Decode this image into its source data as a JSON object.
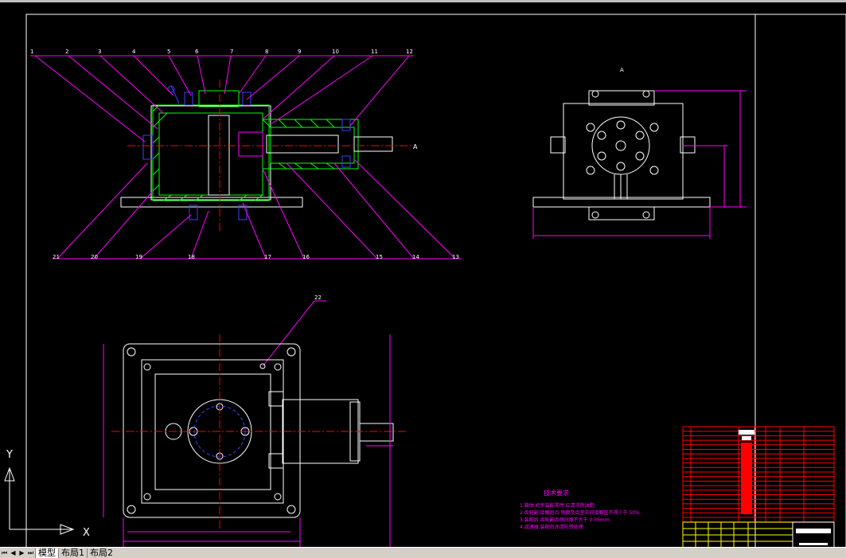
{
  "drawing": {
    "part_labels_top": [
      "1",
      "2",
      "3",
      "4",
      "5",
      "6",
      "7",
      "8",
      "9",
      "10",
      "11",
      "12"
    ],
    "part_labels_bottom": [
      "21",
      "20",
      "19",
      "18",
      "17",
      "16",
      "15",
      "14",
      "13"
    ],
    "part_label_22": "22",
    "view_marker": "A",
    "section_marker": "A",
    "tech_title": "技术要求",
    "tech_notes": [
      "1.箱体 初步装配零件 应清洗除油脂;",
      "2.齿轮副 接触斑点  侧面及齿宽中间接触区不得少于 50%.",
      "3.装配后  齿轮副齿侧间隙不大于 0.05mm.",
      "4.减速器 装配后涂漆防锈处理."
    ]
  },
  "ucs": {
    "y_label": "Y",
    "x_label": "X"
  },
  "layout_tabs": {
    "nav_first": "⏮",
    "nav_prev": "◀",
    "nav_next": "▶",
    "nav_last": "⏭",
    "tabs": [
      "模型",
      "布局1",
      "布局2"
    ],
    "active": "模型"
  },
  "colors": {
    "background": "#000000",
    "line": "#ffffff",
    "leader": "#ff00ff",
    "center": "#ff0000",
    "part": "#00ff00",
    "bolt": "#0000ff",
    "title_block": "#ff0000"
  }
}
